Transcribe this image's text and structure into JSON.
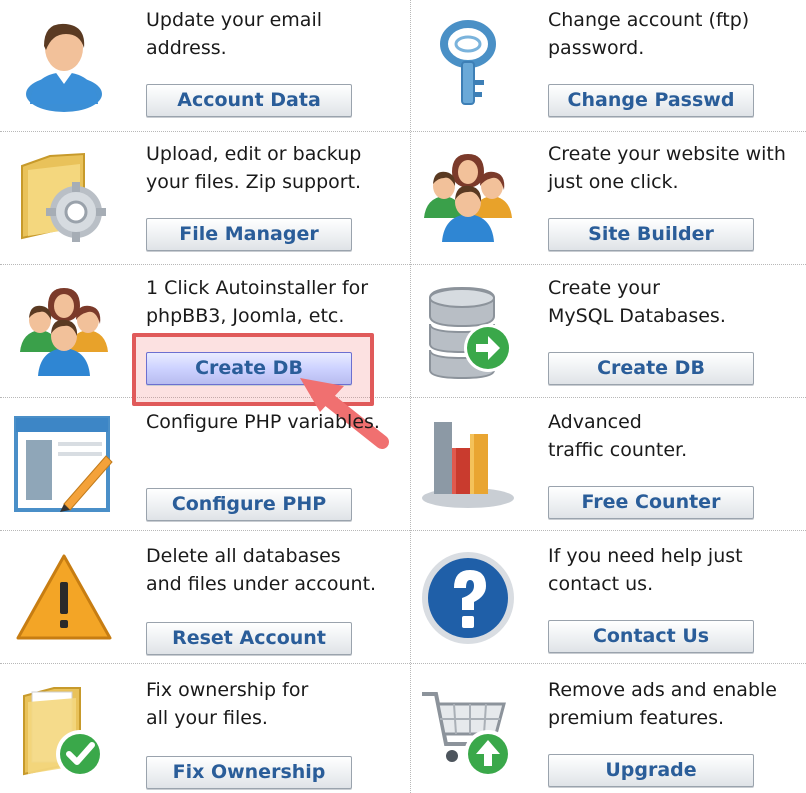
{
  "items": [
    {
      "desc": "Update your email\naddress.",
      "button": "Account Data",
      "icon": "user-icon"
    },
    {
      "desc": "Change account (ftp)\npassword.",
      "button": "Change Passwd",
      "icon": "key-icon"
    },
    {
      "desc": "Upload, edit or backup\nyour files. Zip support.",
      "button": "File Manager",
      "icon": "folder-gear-icon"
    },
    {
      "desc": "Create your website with\njust one click.",
      "button": "Site Builder",
      "icon": "people-group-icon"
    },
    {
      "desc": "1 Click Autoinstaller for\nphpBB3, Joomla, etc.",
      "button": "Create DB",
      "icon": "people-group-icon"
    },
    {
      "desc": "Create your\nMySQL Databases.",
      "button": "Create DB",
      "icon": "database-icon"
    },
    {
      "desc": "Configure PHP variables.",
      "button": "Configure PHP",
      "icon": "settings-window-icon"
    },
    {
      "desc": "Advanced\ntraffic counter.",
      "button": "Free Counter",
      "icon": "bar-chart-icon"
    },
    {
      "desc": "Delete all databases\nand files under account.",
      "button": "Reset Account",
      "icon": "warning-icon"
    },
    {
      "desc": "If you need help just\ncontact us.",
      "button": "Contact Us",
      "icon": "help-icon"
    },
    {
      "desc": "Fix ownership for\nall your files.",
      "button": "Fix Ownership",
      "icon": "folder-check-icon"
    },
    {
      "desc": "Remove ads and enable\npremium features.",
      "button": "Upgrade",
      "icon": "cart-upgrade-icon"
    }
  ],
  "colors": {
    "button_text": "#2a5d99",
    "highlight": "#e05a5a",
    "highlight_arrow": "#f07070"
  }
}
